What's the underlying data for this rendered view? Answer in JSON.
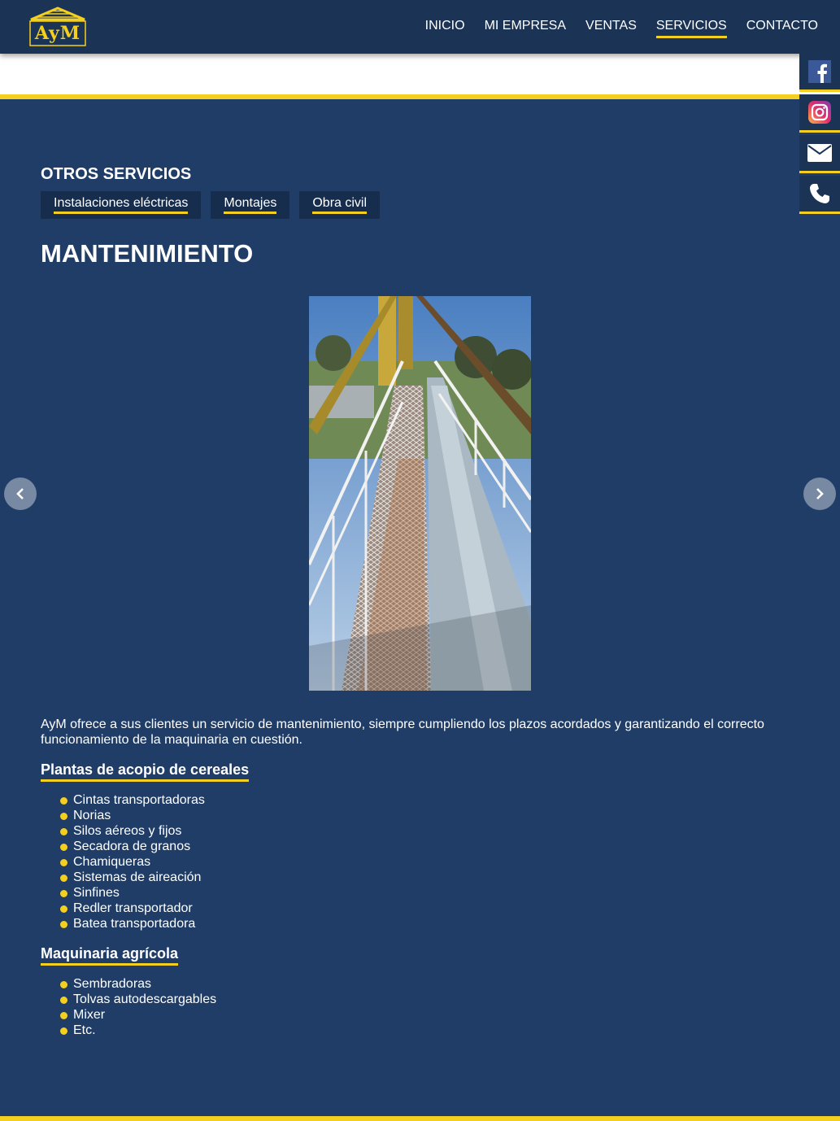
{
  "header": {
    "logo_text": "AyM",
    "nav": [
      {
        "label": "INICIO",
        "active": false
      },
      {
        "label": "MI EMPRESA",
        "active": false
      },
      {
        "label": "VENTAS",
        "active": false
      },
      {
        "label": "SERVICIOS",
        "active": true
      },
      {
        "label": "CONTACTO",
        "active": false
      }
    ]
  },
  "social": [
    "facebook-icon",
    "instagram-icon",
    "envelope-icon",
    "phone-icon"
  ],
  "main": {
    "section_label": "OTROS SERVICIOS",
    "tabs": [
      "Instalaciones eléctricas",
      "Montajes",
      "Obra civil"
    ],
    "title": "MANTENIMIENTO",
    "intro": "AyM ofrece a sus clientes un servicio de mantenimiento, siempre cumpliendo los plazos acordados y garantizando el correcto funcionamiento de la maquinaria en cuestión.",
    "groups": [
      {
        "heading": "Plantas de acopio de cereales",
        "items": [
          "Cintas transportadoras",
          "Norias",
          "Silos aéreos y fijos",
          "Secadora de granos",
          "Chamiqueras",
          "Sistemas de aireación",
          "Sinfines",
          "Redler transportador",
          "Batea transportadora"
        ]
      },
      {
        "heading": "Maquinaria agrícola",
        "items": [
          "Sembradoras",
          "Tolvas autodescargables",
          "Mixer",
          "Etc."
        ]
      }
    ]
  },
  "colors": {
    "background": "#1f3d66",
    "header": "#1b3355",
    "accent": "#f5cf1f"
  }
}
